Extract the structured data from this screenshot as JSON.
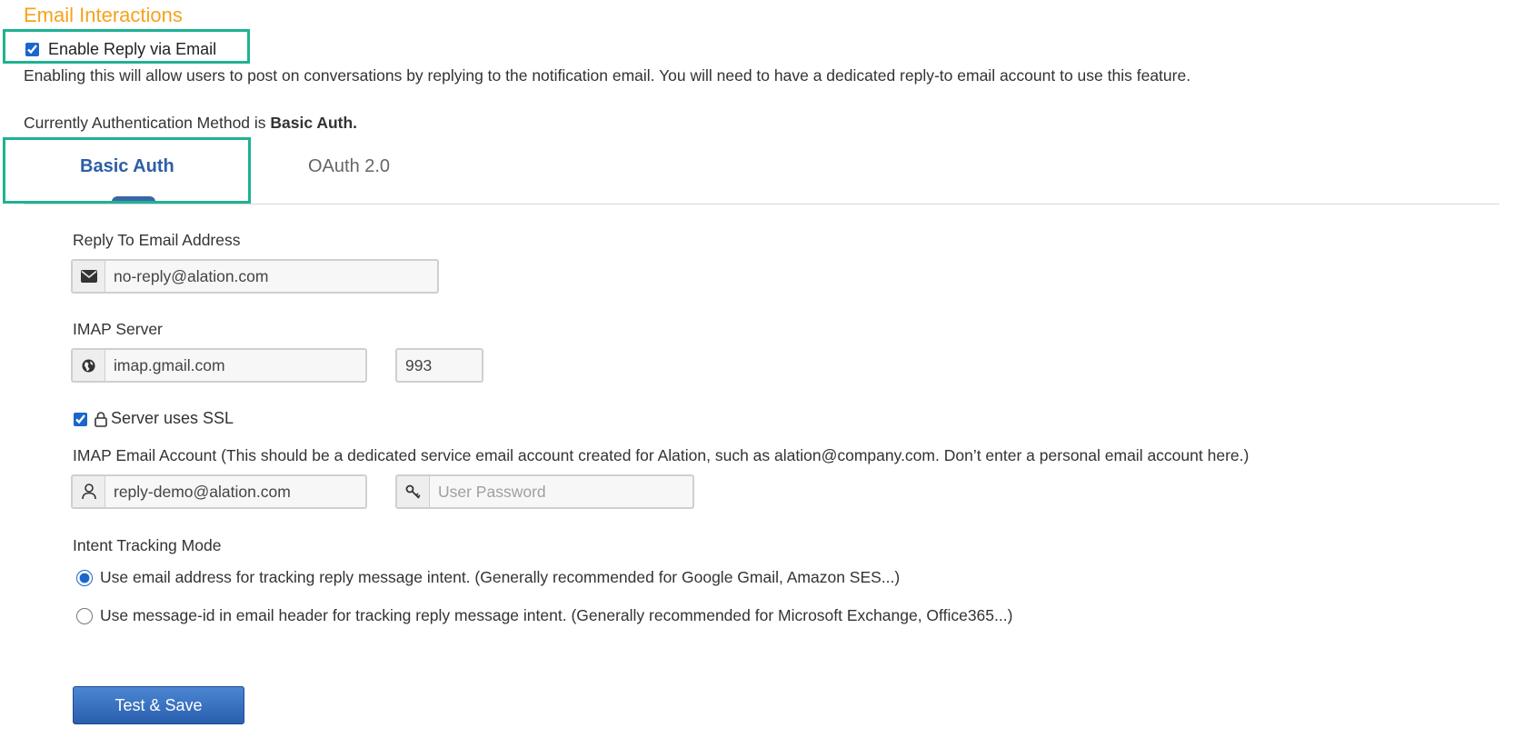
{
  "section": {
    "title": "Email Interactions"
  },
  "enable_reply": {
    "label": "Enable Reply via Email",
    "checked": true,
    "help_text": "Enabling this will allow users to post on conversations by replying to the notification email. You will need to have a dedicated reply-to email account to use this feature."
  },
  "auth_status": {
    "prefix": "Currently Authentication Method is ",
    "method": "Basic Auth."
  },
  "tabs": [
    {
      "label": "Basic Auth",
      "active": true
    },
    {
      "label": "OAuth 2.0",
      "active": false
    }
  ],
  "reply_to": {
    "label": "Reply To Email Address",
    "value": "no-reply@alation.com",
    "icon": "envelope-icon"
  },
  "imap_server": {
    "label": "IMAP Server",
    "host": "imap.gmail.com",
    "port": "993",
    "icon": "globe-icon",
    "ssl_label": "Server uses SSL",
    "ssl_checked": true
  },
  "imap_account": {
    "label": "IMAP Email Account (This should be a dedicated service email account created for Alation, such as alation@company.com. Don’t enter a personal email account here.)",
    "email": "reply-demo@alation.com",
    "password_placeholder": "User Password",
    "user_icon": "user-icon",
    "key_icon": "key-icon"
  },
  "intent_tracking": {
    "label": "Intent Tracking Mode",
    "options": [
      {
        "label": "Use email address for tracking reply message intent. (Generally recommended for Google Gmail, Amazon SES...)",
        "selected": true
      },
      {
        "label": "Use message-id in email header for tracking reply message intent. (Generally recommended for Microsoft Exchange, Office365...)",
        "selected": false
      }
    ]
  },
  "actions": {
    "save_label": "Test & Save"
  },
  "colors": {
    "title": "#f7a21b",
    "highlight": "#1fb294",
    "tab_active": "#2d5ea6",
    "button": "#2a5fae"
  }
}
